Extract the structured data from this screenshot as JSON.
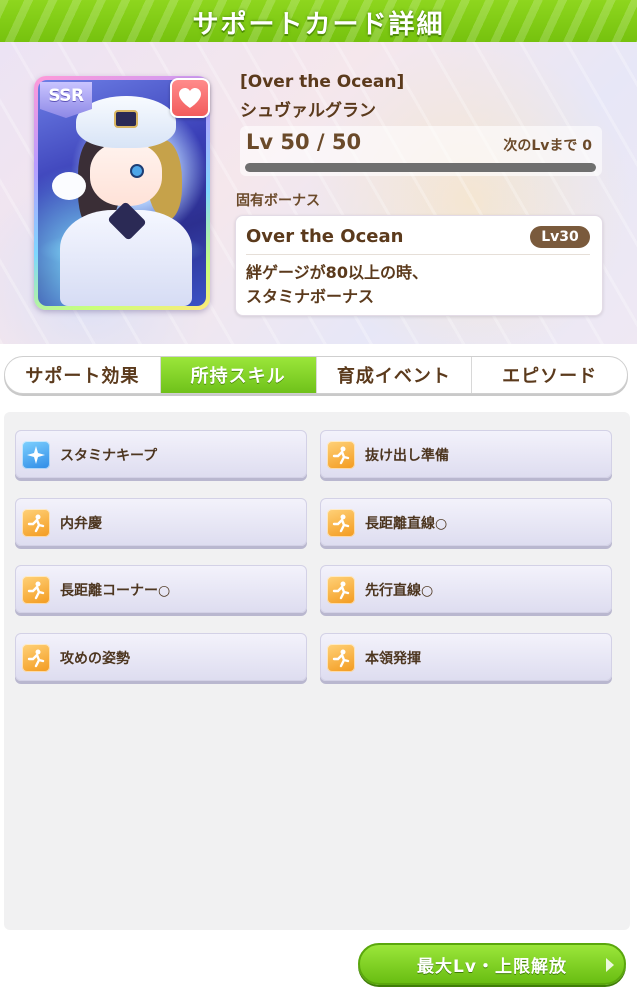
{
  "header": {
    "title": "サポートカード詳細"
  },
  "card": {
    "rarity": "SSR",
    "title": "[Over the Ocean]",
    "name": "シュヴァルグラン",
    "level_text": "Lv 50 / 50",
    "next_level_text": "次のLvまで 0",
    "level_progress": 1.0,
    "favorite_icon": "heart-icon"
  },
  "unique_bonus": {
    "label": "固有ボーナス",
    "name": "Over the Ocean",
    "level_tag": "Lv30",
    "desc_line1": "絆ゲージが80以上の時、",
    "desc_line2": "スタミナボーナス"
  },
  "tabs": [
    {
      "label": "サポート効果",
      "active": false
    },
    {
      "label": "所持スキル",
      "active": true
    },
    {
      "label": "育成イベント",
      "active": false
    },
    {
      "label": "エピソード",
      "active": false
    }
  ],
  "skills": [
    {
      "label": "スタミナキープ",
      "icon": "stamina-sparkle-icon",
      "icon_color": "#2e8ae6"
    },
    {
      "label": "抜け出し準備",
      "icon": "runner-icon",
      "icon_color": "#f39a1e"
    },
    {
      "label": "内弁慶",
      "icon": "runner-icon",
      "icon_color": "#f39a1e"
    },
    {
      "label": "長距離直線○",
      "icon": "runner-icon",
      "icon_color": "#f39a1e"
    },
    {
      "label": "長距離コーナー○",
      "icon": "runner-icon",
      "icon_color": "#f39a1e"
    },
    {
      "label": "先行直線○",
      "icon": "runner-icon",
      "icon_color": "#f39a1e"
    },
    {
      "label": "攻めの姿勢",
      "icon": "runner-icon",
      "icon_color": "#f39a1e"
    },
    {
      "label": "本領発揮",
      "icon": "runner-icon",
      "icon_color": "#f39a1e"
    }
  ],
  "footer": {
    "max_button_label": "最大Lv・上限解放"
  },
  "colors": {
    "accent_green": "#76c20e",
    "text_brown": "#5b3a1c"
  }
}
